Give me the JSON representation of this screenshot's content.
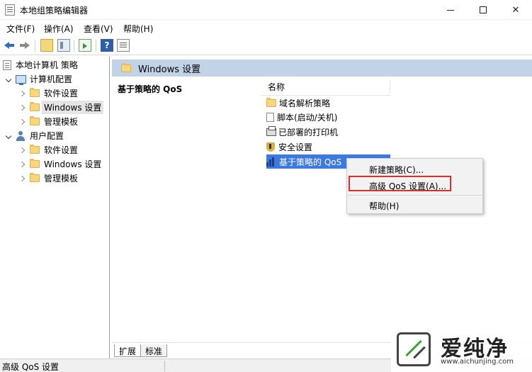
{
  "window": {
    "title": "本地组策略编辑器",
    "minimize": "—",
    "maximize": "□",
    "close": "✕"
  },
  "menu": [
    "文件(F)",
    "操作(A)",
    "查看(V)",
    "帮助(H)"
  ],
  "toolbar": {
    "icons": [
      "back-arrow-icon",
      "forward-arrow-icon",
      "up-folder-icon",
      "show-hide-tree-icon",
      "export-list-icon",
      "help-icon",
      "properties-icon"
    ],
    "help_glyph": "?"
  },
  "tree": {
    "root": "本地计算机 策略",
    "computer_config": "计算机配置",
    "computer_children": [
      "软件设置",
      "Windows 设置",
      "管理模板"
    ],
    "user_config": "用户配置",
    "user_children": [
      "软件设置",
      "Windows 设置",
      "管理模板"
    ]
  },
  "right": {
    "header": "Windows 设置",
    "desc_title": "基于策略的 QoS",
    "column_name": "名称",
    "items": [
      "域名解析策略",
      "脚本(启动/关机)",
      "已部署的打印机",
      "安全设置",
      "基于策略的 QoS"
    ]
  },
  "context_menu": {
    "items": [
      "新建策略(C)...",
      "高级 QoS 设置(A)...",
      "帮助(H)"
    ]
  },
  "tabs": [
    "扩展",
    "标准"
  ],
  "status": {
    "text": "高级 QoS 设置"
  },
  "watermark": {
    "brand": "爱纯净",
    "url": "www.aichunjing.com"
  },
  "colors": {
    "selection": "#3d7ae0",
    "header_bg": "#c2d3e8",
    "highlight_border": "#d9302e"
  }
}
